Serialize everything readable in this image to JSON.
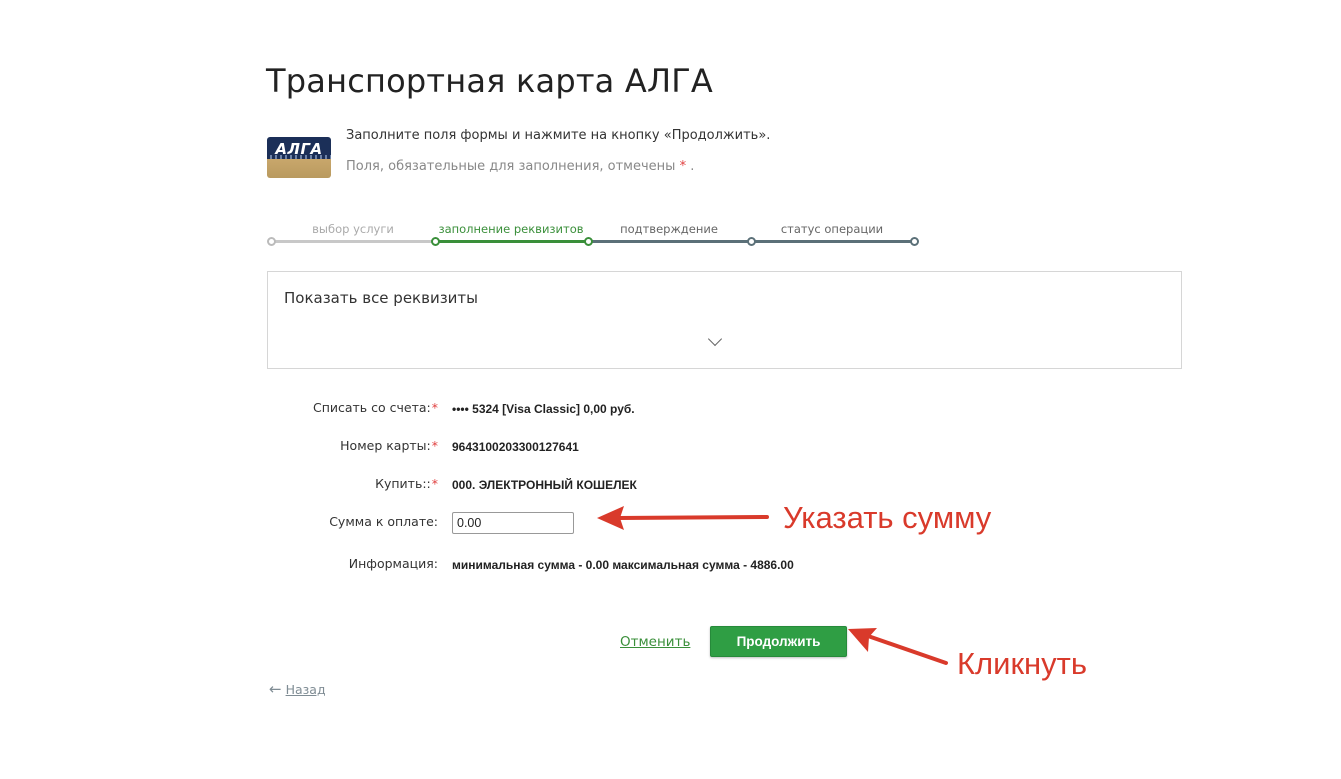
{
  "page": {
    "title": "Транспортная карта АЛГА",
    "logo_text": "АЛГА",
    "intro": "Заполните поля формы и нажмите на кнопку «Продолжить».",
    "required_note": "Поля, обязательные для заполнения, отмечены",
    "required_star": "*",
    "required_dot": "."
  },
  "steps": [
    {
      "label": "выбор услуги",
      "state": "done"
    },
    {
      "label": "заполнение реквизитов",
      "state": "active"
    },
    {
      "label": "подтверждение",
      "state": "future"
    },
    {
      "label": "статус операции",
      "state": "future"
    }
  ],
  "details": {
    "title": "Показать все реквизиты"
  },
  "form": {
    "account_label": "Списать со счета:",
    "account_value": "•••• 5324  [Visa Classic] 0,00   руб.",
    "card_label": "Номер карты:",
    "card_value": "9643100203300127641",
    "buy_label": "Купить::",
    "buy_value": "000. ЭЛЕКТРОННЫЙ КОШЕЛЕК",
    "amount_label": "Сумма к оплате:",
    "amount_value": "0.00",
    "info_label": "Информация:",
    "info_value": "минимальная сумма - 0.00 максимальная сумма - 4886.00",
    "required_star": "*"
  },
  "actions": {
    "cancel": "Отменить",
    "continue": "Продолжить",
    "back": "Назад",
    "back_arrow": "←"
  },
  "annotations": {
    "amount_hint": "Указать сумму",
    "click_hint": "Кликнуть",
    "color": "#d93a2b"
  },
  "colors": {
    "accent_green": "#2f9e44",
    "step_green": "#3a8f3a",
    "step_slate": "#5b7078",
    "step_done": "#bbbbbb"
  }
}
